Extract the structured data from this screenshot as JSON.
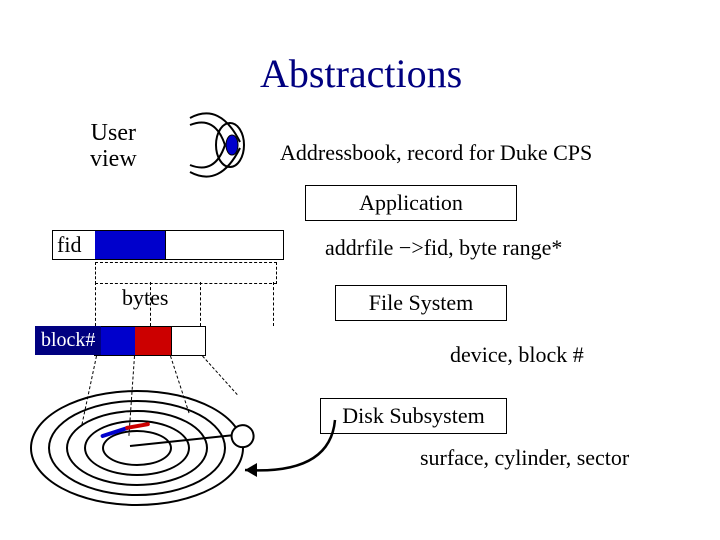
{
  "title": "Abstractions",
  "user_view_label": "User\nview",
  "captions": {
    "record": "Addressbook, record for Duke CPS",
    "fid_map": "addrfile −>fid, byte range*",
    "device": "device, block #",
    "surface": "surface, cylinder, sector"
  },
  "boxes": {
    "application": "Application",
    "filesystem": "File System",
    "disksubsystem": "Disk Subsystem"
  },
  "left_labels": {
    "fid": "fid",
    "bytes": "bytes",
    "block": "block#"
  }
}
